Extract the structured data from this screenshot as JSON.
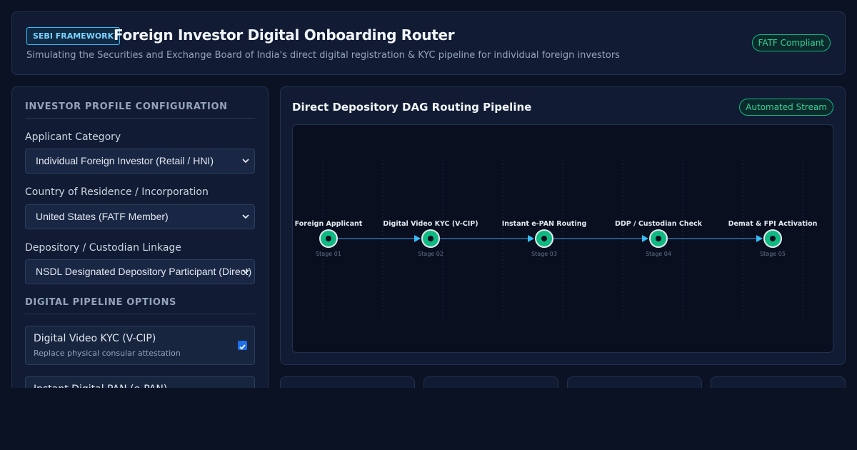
{
  "header": {
    "badge": "SEBI FRAMEWORK",
    "title": "Foreign Investor Digital Onboarding Router",
    "subtitle": "Simulating the Securities and Exchange Board of India's direct digital registration & KYC pipeline for individual foreign investors",
    "status_badge": "FATF Compliant"
  },
  "profile": {
    "section_title": "INVESTOR PROFILE CONFIGURATION",
    "fields": [
      {
        "label": "Applicant Category",
        "value": "Individual Foreign Investor (Retail / HNI)"
      },
      {
        "label": "Country of Residence / Incorporation",
        "value": "United States (FATF Member)"
      },
      {
        "label": "Depository / Custodian Linkage",
        "value": "NSDL Designated Depository Participant (Direct)"
      }
    ]
  },
  "options": {
    "section_title": "DIGITAL PIPELINE OPTIONS",
    "items": [
      {
        "name": "Digital Video KYC (V-CIP)",
        "desc": "Replace physical consular attestation",
        "checked": true
      },
      {
        "name": "Instant Digital PAN (e-PAN)",
        "desc": "",
        "checked": true
      }
    ]
  },
  "pipeline": {
    "title": "Direct Depository DAG Routing Pipeline",
    "status_badge": "Automated Stream",
    "stages": [
      {
        "name": "Foreign Applicant",
        "label": "Stage 01"
      },
      {
        "name": "Digital Video KYC (V-CIP)",
        "label": "Stage 02"
      },
      {
        "name": "Instant e-PAN Routing",
        "label": "Stage 03"
      },
      {
        "name": "DDP / Custodian Check",
        "label": "Stage 04"
      },
      {
        "name": "Demat & FPI Activation",
        "label": "Stage 05"
      }
    ]
  },
  "colors": {
    "accent": "#38bdf8",
    "success": "#10b981",
    "node_fill": "#10b981",
    "background": "#0b1224"
  }
}
